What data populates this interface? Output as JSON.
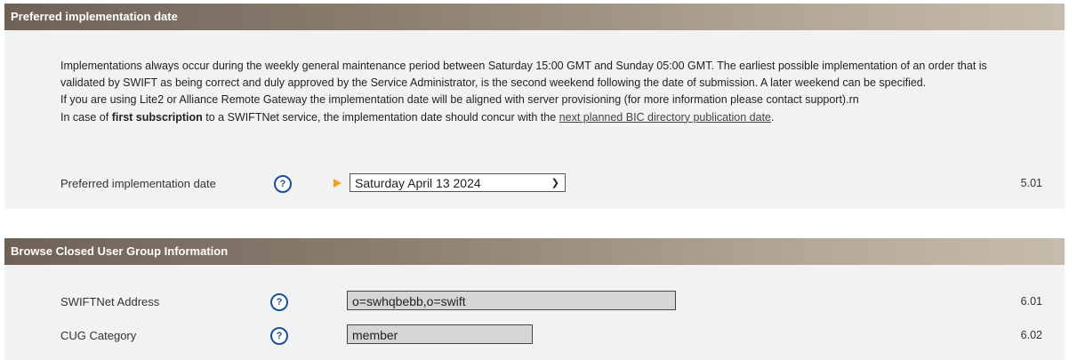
{
  "section1": {
    "title": "Preferred implementation date",
    "intro_line1": "Implementations always occur during the weekly general maintenance period between Saturday 15:00 GMT and Sunday 05:00 GMT. The earliest possible implementation of an order that is validated by SWIFT as being correct and duly approved by the Service Administrator, is the second weekend following the date of submission. A later weekend can be specified.",
    "intro_line2": "If you are using Lite2 or Alliance Remote Gateway the implementation date will be aligned with server provisioning (for more information please contact support).rn",
    "intro_line3_pre": "In case of ",
    "intro_line3_bold": "first subscription",
    "intro_line3_mid": " to a SWIFTNet service, the implementation date should concur with the ",
    "intro_line3_link": "next planned BIC directory publication date",
    "intro_line3_post": ".",
    "row_label": "Preferred implementation date",
    "help_glyph": "?",
    "selected_date": "Saturday April 13 2024",
    "row_number": "5.01"
  },
  "section2": {
    "title": "Browse Closed User Group Information",
    "help_glyph": "?",
    "rows": [
      {
        "label": "SWIFTNet Address",
        "value": "o=swhqbebb,o=swift",
        "number": "6.01"
      },
      {
        "label": "CUG Category",
        "value": "member",
        "number": "6.02"
      }
    ]
  },
  "icons": {
    "help": "help-icon",
    "pointer": "orange-pointer-icon",
    "dropdown": "chevron-down-icon"
  },
  "colors": {
    "header_start": "#6e6256",
    "header_end": "#c6bcae",
    "panel_bg": "#f2f2f2",
    "help_icon": "#1a4fa0",
    "pointer": "#f0a020",
    "readonly_field": "#d6d6d6"
  }
}
